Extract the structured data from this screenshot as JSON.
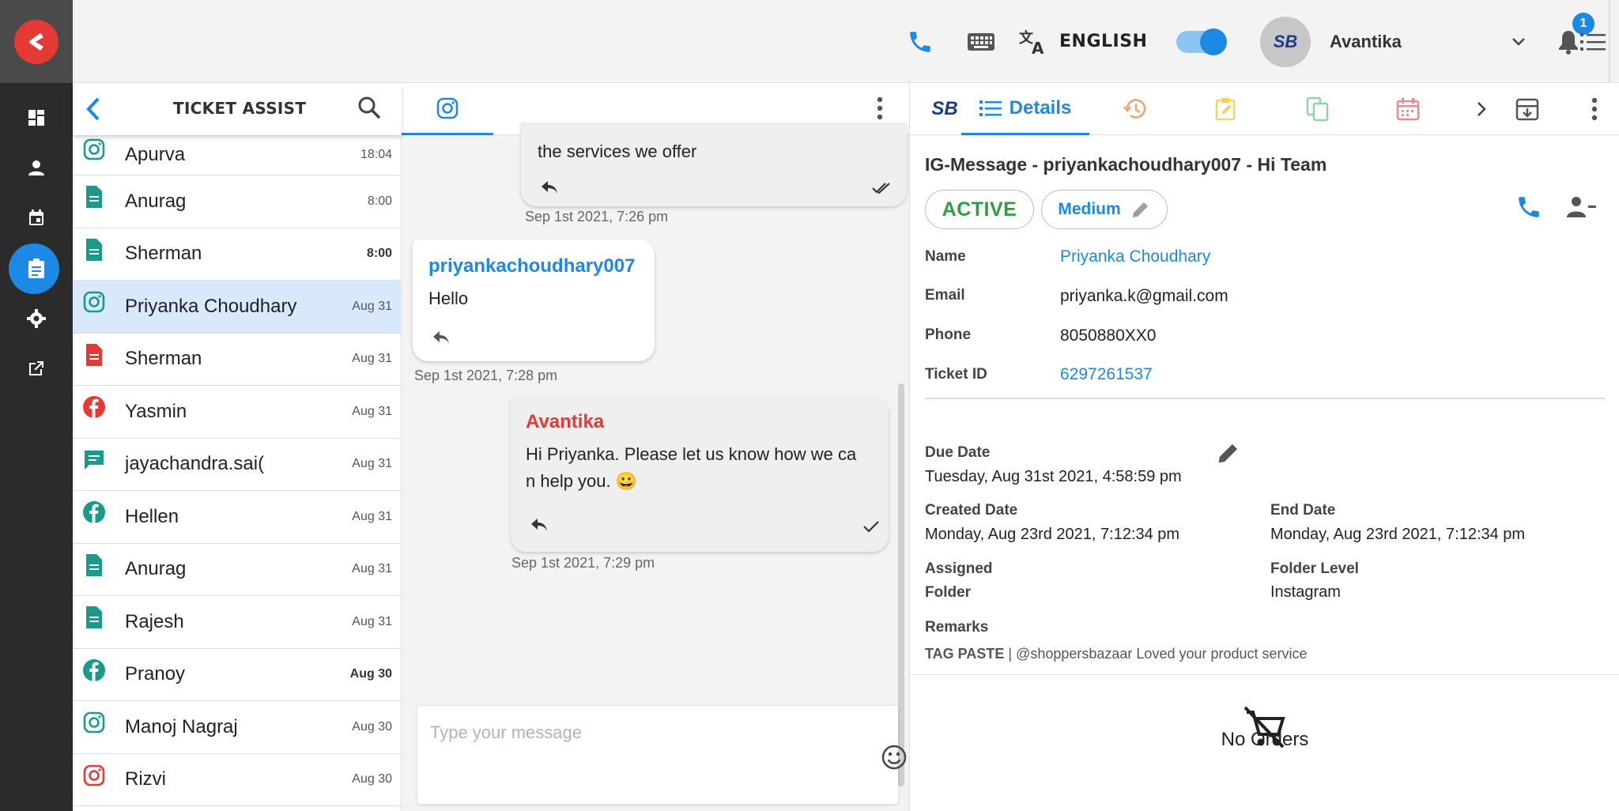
{
  "topbar": {
    "language": "ENGLISH",
    "user_name": "Avantika",
    "avatar_logo": "SB",
    "notification_count": "1",
    "toggle_on": true
  },
  "rail": {
    "items": [
      "dashboard-icon",
      "user-icon",
      "calendar-icon",
      "clipboard-icon",
      "gear-icon",
      "external-link-icon"
    ],
    "active_index": 3
  },
  "ticket_list": {
    "title": "TICKET ASSIST",
    "rows": [
      {
        "name": "Apurva",
        "time": "18:04",
        "channel": "instagram",
        "bold": false
      },
      {
        "name": "Anurag",
        "time": "8:00",
        "channel": "document",
        "bold": false
      },
      {
        "name": "Sherman",
        "time": "8:00",
        "channel": "document",
        "bold": true
      },
      {
        "name": "Priyanka Choudhary",
        "time": "Aug 31",
        "channel": "instagram",
        "bold": false,
        "selected": true
      },
      {
        "name": "Sherman",
        "time": "Aug 31",
        "channel": "document-red",
        "bold": false
      },
      {
        "name": "Yasmin",
        "time": "Aug 31",
        "channel": "facebook-red",
        "bold": false
      },
      {
        "name": "jayachandra.sai(",
        "time": "Aug 31",
        "channel": "chat",
        "bold": false
      },
      {
        "name": "Hellen",
        "time": "Aug 31",
        "channel": "facebook",
        "bold": false
      },
      {
        "name": "Anurag",
        "time": "Aug 31",
        "channel": "document",
        "bold": false
      },
      {
        "name": "Rajesh",
        "time": "Aug 31",
        "channel": "document",
        "bold": false
      },
      {
        "name": "Pranoy",
        "time": "Aug 30",
        "channel": "facebook",
        "bold": true
      },
      {
        "name": "Manoj Nagraj",
        "time": "Aug 30",
        "channel": "instagram",
        "bold": false
      },
      {
        "name": "Rizvi",
        "time": "Aug 30",
        "channel": "instagram-red",
        "bold": false
      }
    ]
  },
  "chat": {
    "msg1": {
      "text": "the services we offer",
      "time": "Sep 1st 2021, 7:26 pm"
    },
    "msg2": {
      "sender": "priyankachoudhary007",
      "text": "Hello",
      "time": "Sep 1st 2021, 7:28 pm"
    },
    "msg3": {
      "sender": "Avantika",
      "line1": "Hi Priyanka. Please let us know how we ca",
      "line2": "n help you. 😀",
      "time": "Sep 1st 2021, 7:29 pm"
    },
    "composer_placeholder": "Type your message"
  },
  "details": {
    "tab_active": "Details",
    "title": "IG-Message - priyankachoudhary007 - Hi Team",
    "status": "ACTIVE",
    "priority": "Medium",
    "fields": {
      "name_label": "Name",
      "name_value": "Priyanka Choudhary",
      "email_label": "Email",
      "email_value": "priyanka.k@gmail.com",
      "phone_label": "Phone",
      "phone_value": "8050880XX0",
      "ticket_label": "Ticket ID",
      "ticket_value": "6297261537"
    },
    "due_date_label": "Due Date",
    "due_date_value": "Tuesday, Aug 31st 2021, 4:58:59 pm",
    "created_label": "Created Date",
    "created_value": "Monday, Aug 23rd 2021, 7:12:34 pm",
    "end_label": "End Date",
    "end_value": "Monday, Aug 23rd 2021, 7:12:34 pm",
    "assigned_label": "Assigned",
    "assigned_value": "Folder",
    "folder_level_label": "Folder Level",
    "folder_level_value": "Instagram",
    "remarks_label": "Remarks",
    "remarks_tag": "TAG PASTE",
    "remarks_sep": "|",
    "remarks_value": "@shoppersbazaar Loved your product service",
    "orders_label": "No Orders"
  },
  "colors": {
    "accent": "#1e88e5",
    "rail": "#2b2b2b",
    "active_green": "#2e9e3e",
    "brand_red": "#e53935"
  }
}
